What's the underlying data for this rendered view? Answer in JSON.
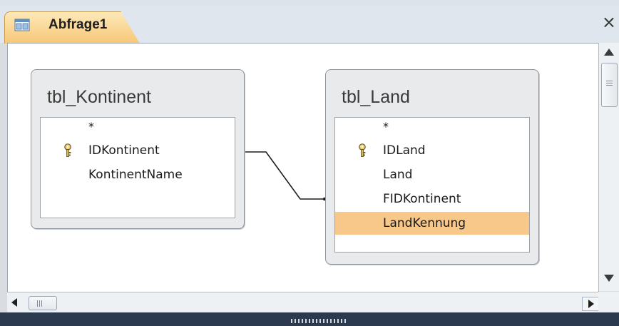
{
  "window": {
    "tab_title": "Abfrage1",
    "tab_icon": "query-design-icon",
    "close_symbol": "×"
  },
  "tables": [
    {
      "name": "tbl_Kontinent",
      "star": "*",
      "fields": [
        {
          "label": "IDKontinent",
          "primary_key": true
        },
        {
          "label": "KontinentName",
          "primary_key": false
        }
      ]
    },
    {
      "name": "tbl_Land",
      "star": "*",
      "fields": [
        {
          "label": "IDLand",
          "primary_key": true
        },
        {
          "label": "Land",
          "primary_key": false
        },
        {
          "label": "FIDKontinent",
          "primary_key": false
        },
        {
          "label": "LandKennung",
          "primary_key": false,
          "selected": true
        }
      ]
    }
  ],
  "relationship": {
    "from": "tbl_Kontinent.IDKontinent",
    "to": "tbl_Land.FIDKontinent"
  },
  "colors": {
    "tab_fill": "#f7c777",
    "selected_row": "#f7c88a",
    "canvas": "#ffffff",
    "table_frame": "#e9eaeb"
  }
}
